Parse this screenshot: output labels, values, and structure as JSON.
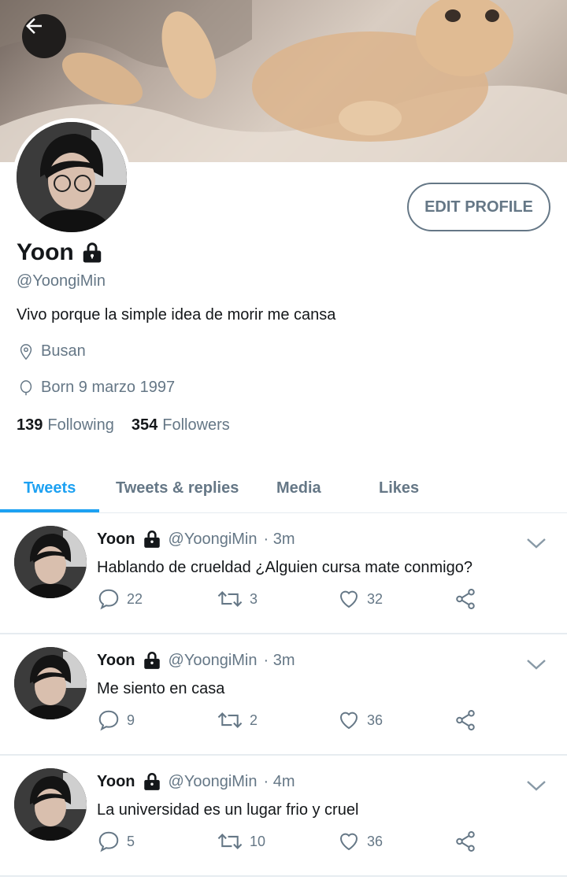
{
  "profile": {
    "name": "Yoon",
    "handle": "@YoongiMin",
    "bio": "Vivo porque la simple idea de morir me cansa",
    "location": "Busan",
    "born": "Born 9 marzo 1997",
    "following_count": "139",
    "following_label": "Following",
    "followers_count": "354",
    "followers_label": "Followers",
    "edit_button": "EDIT PROFILE"
  },
  "tabs": [
    {
      "label": "Tweets"
    },
    {
      "label": "Tweets & replies"
    },
    {
      "label": "Media"
    },
    {
      "label": "Likes"
    }
  ],
  "tweets": [
    {
      "name": "Yoon",
      "handle": "@YoongiMin",
      "time": "· 3m",
      "text": "Hablando de crueldad ¿Alguien cursa mate conmigo?",
      "replies": "22",
      "retweets": "3",
      "likes": "32"
    },
    {
      "name": "Yoon",
      "handle": "@YoongiMin",
      "time": "· 3m",
      "text": "Me siento en casa",
      "replies": "9",
      "retweets": "2",
      "likes": "36"
    },
    {
      "name": "Yoon",
      "handle": "@YoongiMin",
      "time": "· 4m",
      "text": "La universidad es un lugar frio y cruel",
      "replies": "5",
      "retweets": "10",
      "likes": "36"
    }
  ],
  "colors": {
    "accent": "#1da1f2",
    "muted": "#657786",
    "text": "#14171a",
    "divider": "#e6ecf0"
  },
  "icons": {
    "back": "arrow-left-icon",
    "lock": "lock-icon",
    "location": "location-pin-icon",
    "birthday": "balloon-icon",
    "reply": "reply-icon",
    "retweet": "retweet-icon",
    "like": "heart-icon",
    "share": "share-icon",
    "chevron": "chevron-down-icon"
  }
}
